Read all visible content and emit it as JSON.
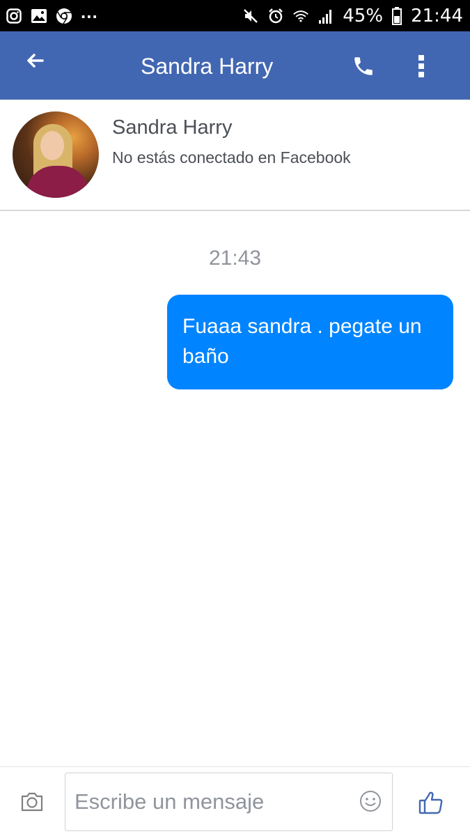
{
  "status_bar": {
    "left_icons": [
      "instagram-icon",
      "gallery-icon",
      "chrome-icon"
    ],
    "overflow": "...",
    "right_icons": [
      "mute-icon",
      "alarm-icon",
      "wifi-icon",
      "signal-icon",
      "battery-icon"
    ],
    "battery": "45%",
    "time": "21:44"
  },
  "app_bar": {
    "title": "Sandra Harry",
    "color": "#4267b2",
    "icons": [
      "back-arrow-icon",
      "phone-icon",
      "more-vertical-icon"
    ]
  },
  "contact": {
    "name": "Sandra Harry",
    "status": "No estás conectado en Facebook"
  },
  "conversation": {
    "timestamp": "21:43",
    "messages": [
      {
        "sender": "me",
        "text": "Fuaaa sandra . pegate un baño",
        "color": "#0084ff"
      }
    ]
  },
  "composer": {
    "placeholder": "Escribe un mensaje",
    "value": "",
    "icons": [
      "camera-icon",
      "emoji-icon",
      "thumbs-up-icon"
    ],
    "accent": "#4267b2"
  }
}
